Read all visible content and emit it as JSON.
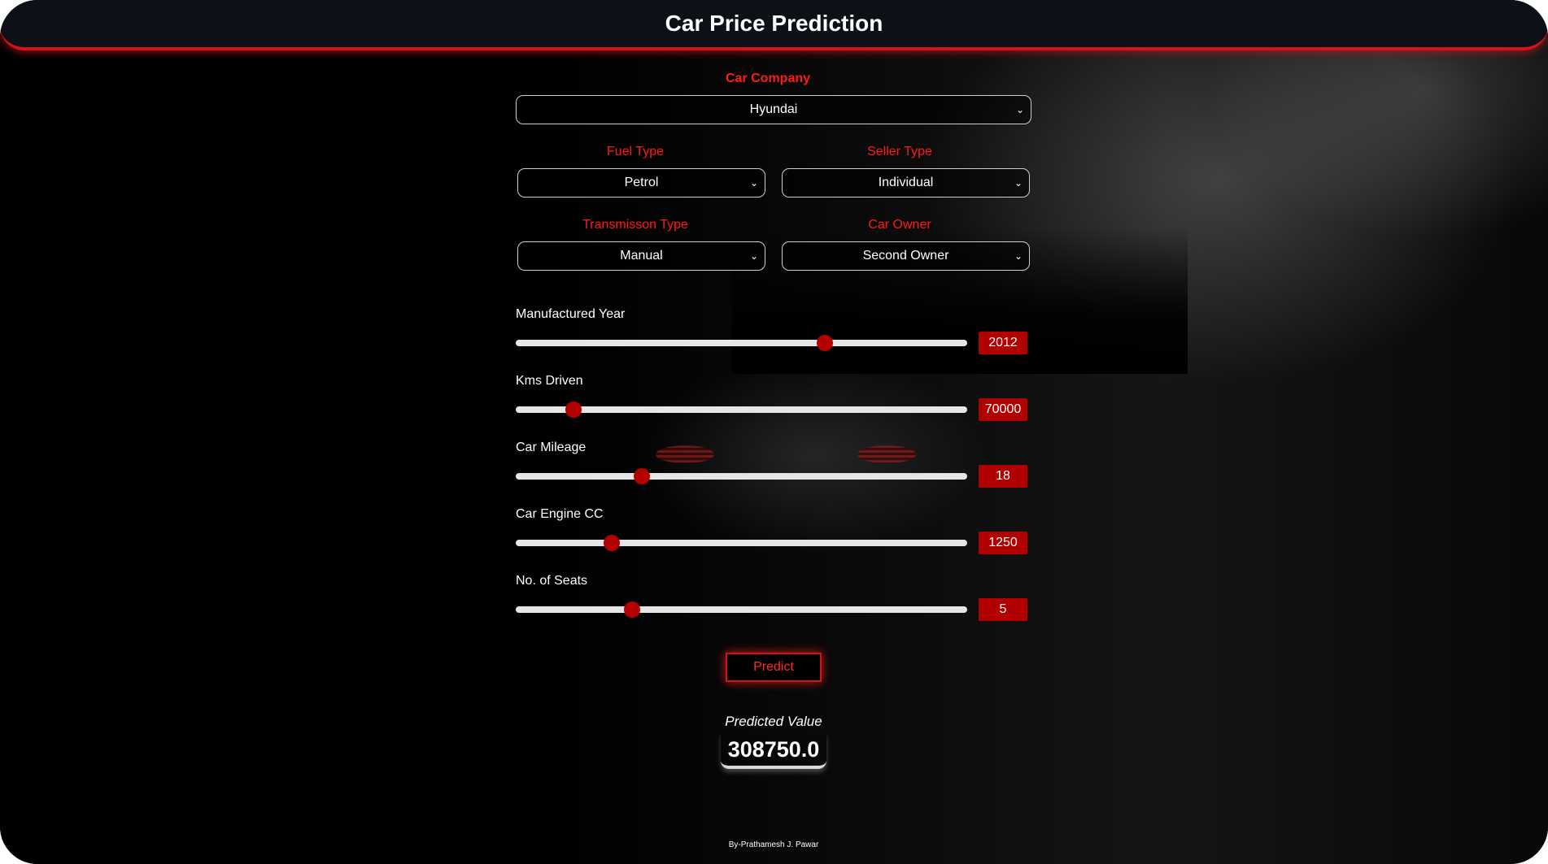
{
  "app": {
    "title": "Car Price Prediction"
  },
  "car_company": {
    "label": "Car Company",
    "value": "Hyundai"
  },
  "fuel_type": {
    "label": "Fuel Type",
    "value": "Petrol"
  },
  "seller_type": {
    "label": "Seller Type",
    "value": "Individual"
  },
  "transmission_type": {
    "label": "Transmisson Type",
    "value": "Manual"
  },
  "car_owner": {
    "label": "Car Owner",
    "value": "Second Owner"
  },
  "sliders": {
    "year": {
      "label": "Manufactured Year",
      "value": "2012",
      "fraction": 0.685
    },
    "kms": {
      "label": "Kms Driven",
      "value": "70000",
      "fraction": 0.128
    },
    "mileage": {
      "label": "Car Mileage",
      "value": "18",
      "fraction": 0.28
    },
    "engine": {
      "label": "Car Engine CC",
      "value": "1250",
      "fraction": 0.213
    },
    "seats": {
      "label": "No. of Seats",
      "value": "5",
      "fraction": 0.258
    }
  },
  "predict_button": {
    "label": "Predict"
  },
  "result": {
    "label": "Predicted Value",
    "value": "308750.0"
  },
  "footer": {
    "text": "By-Prathamesh J. Pawar"
  },
  "colors": {
    "accent": "#d0141c",
    "thumb": "#b30000",
    "label_red": "#ff1a1a"
  },
  "icons": {
    "dropdown": "chevron-down-icon"
  }
}
